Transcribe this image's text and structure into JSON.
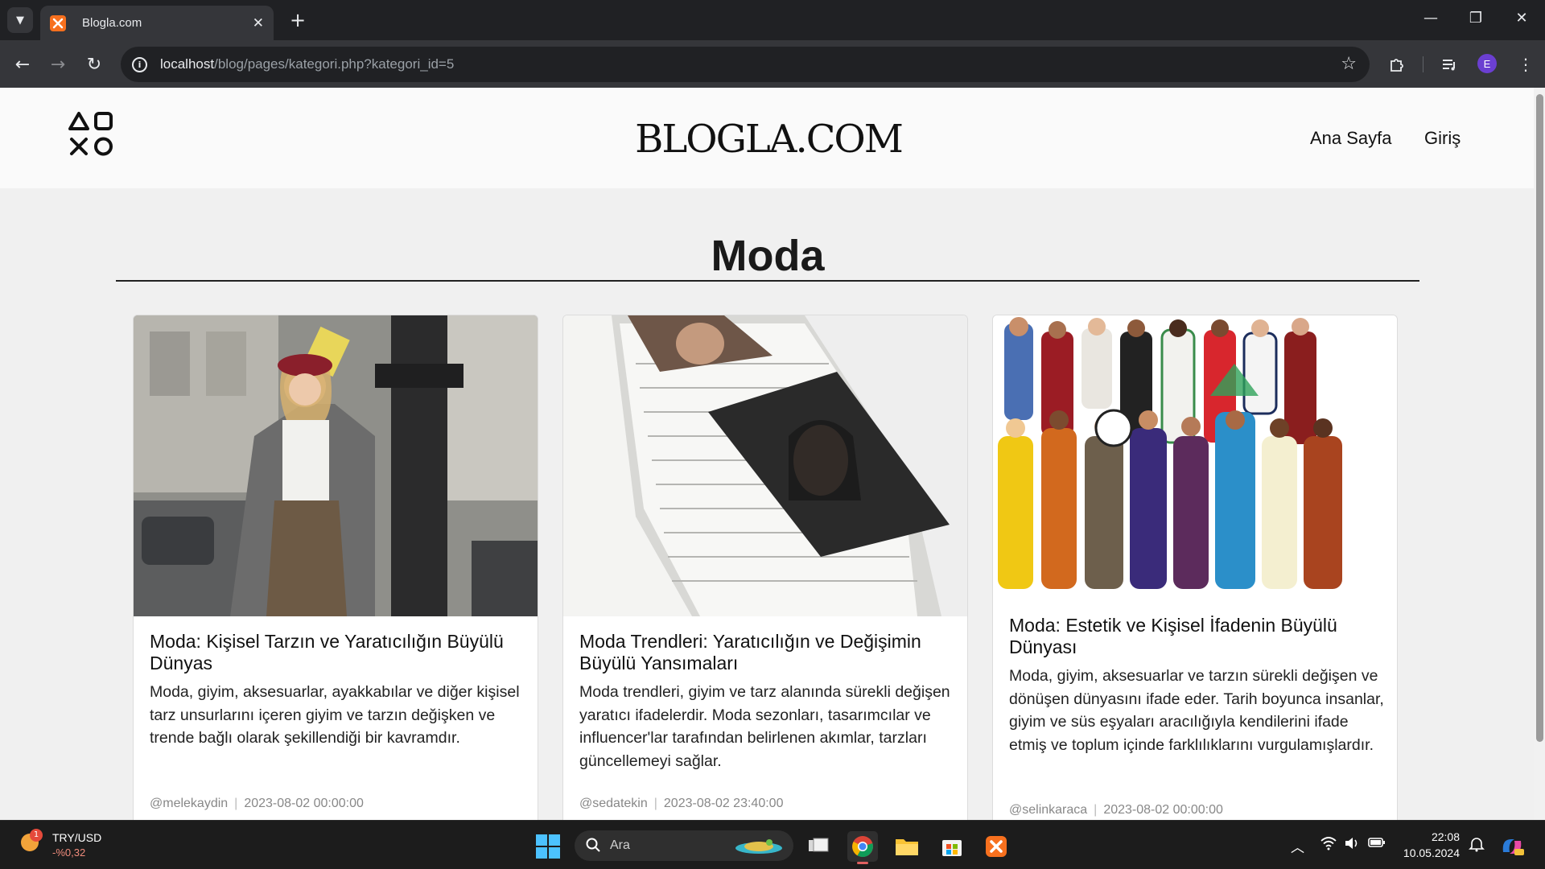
{
  "browser": {
    "tab_title": "Blogla.com",
    "url_host": "localhost",
    "url_path": "/blog/pages/kategori.php?kategori_id=5",
    "profile_initial": "E"
  },
  "site": {
    "brand": "BLOGLA.COM",
    "nav": {
      "home": "Ana Sayfa",
      "login": "Giriş"
    },
    "page_title": "Moda"
  },
  "cards": [
    {
      "title": "Moda: Kişisel Tarzın ve Yaratıcılığın Büyülü Dünyas",
      "text": "Moda, giyim, aksesuarlar, ayakkabılar ve diğer kişisel tarz unsurlarını içeren giyim ve tarzın değişken ve trende bağlı olarak şekillendiği bir kavramdır.",
      "author": "@melekaydin",
      "date": "2023-08-02 00:00:00",
      "image": "street-fashion-woman-photo"
    },
    {
      "title": "Moda Trendleri: Yaratıcılığın ve Değişimin Büyülü Yansımaları",
      "text": "Moda trendleri, giyim ve tarz alanında sürekli değişen yaratıcı ifadelerdir. Moda sezonları, tasarımcılar ve influencer'lar tarafından belirlenen akımlar, tarzları güncellemeyi sağlar.",
      "author": "@sedatekin",
      "date": "2023-08-02 23:40:00",
      "image": "magazine-stack-photo"
    },
    {
      "title": "Moda: Estetik ve Kişisel İfadenin Büyülü Dünyası",
      "text": "Moda, giyim, aksesuarlar ve tarzın sürekli değişen ve dönüşen dünyasını ifade eder. Tarih boyunca insanlar, giyim ve süs eşyaları aracılığıyla kendilerini ifade etmiş ve toplum içinde farklılıklarını vurgulamışlardır.",
      "author": "@selinkaraca",
      "date": "2023-08-02 00:00:00",
      "image": "traditional-costumes-illustration"
    }
  ],
  "taskbar": {
    "widget_title": "TRY/USD",
    "widget_value": "-%0,32",
    "widget_badge": "1",
    "search_placeholder": "Ara",
    "time": "22:08",
    "date": "10.05.2024"
  },
  "colors": {
    "chrome_dark": "#202124",
    "chrome_toolbar": "#35363a",
    "page_bg": "#f0f0f0",
    "header_bg": "#fafafa",
    "xampp_orange": "#f7701e",
    "profile_purple": "#6b3fd1"
  }
}
